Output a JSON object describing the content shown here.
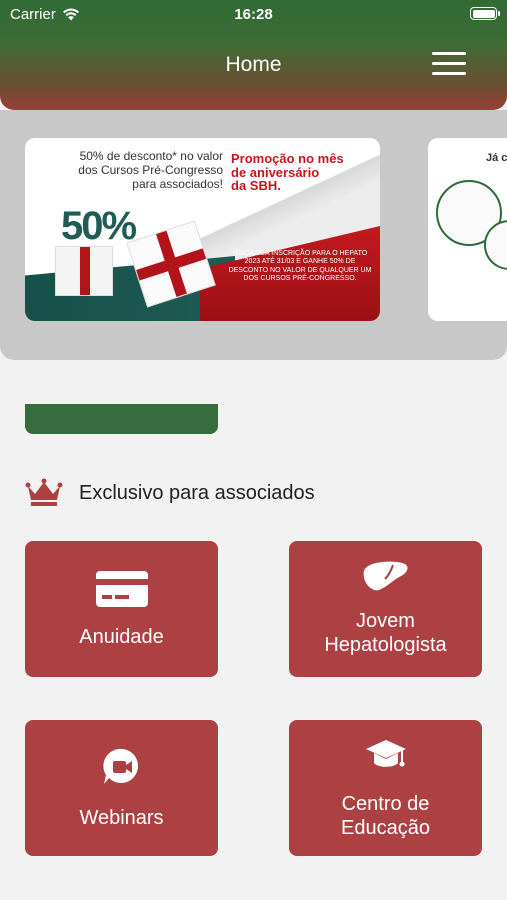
{
  "status_bar": {
    "carrier": "Carrier",
    "time": "16:28"
  },
  "header": {
    "title": "Home"
  },
  "banner": {
    "left_text": "50% de desconto* no valor\ndos Cursos Pré-Congresso\npara associados!",
    "right_text": "Promoção no mês\nde aniversário\nda SBH.",
    "fine_print": "*Faça sua inscrição para o Hepato 2023 até 31/03 e ganhe 50% de desconto no valor de qualquer um dos cursos pré-congresso.",
    "big_number": "50%",
    "second_card_text": "Já c"
  },
  "section": {
    "title": "Exclusivo para associados"
  },
  "tiles": [
    {
      "label": "Anuidade",
      "icon": "credit-card-icon"
    },
    {
      "label": "Jovem\nHepatologista",
      "icon": "liver-icon"
    },
    {
      "label": "Webinars",
      "icon": "video-chat-icon"
    },
    {
      "label": "Centro de\nEducação",
      "icon": "graduation-cap-icon"
    }
  ],
  "colors": {
    "tile": "#ad4043",
    "header_green": "#2f6b35",
    "accent_red": "#c5161d"
  }
}
